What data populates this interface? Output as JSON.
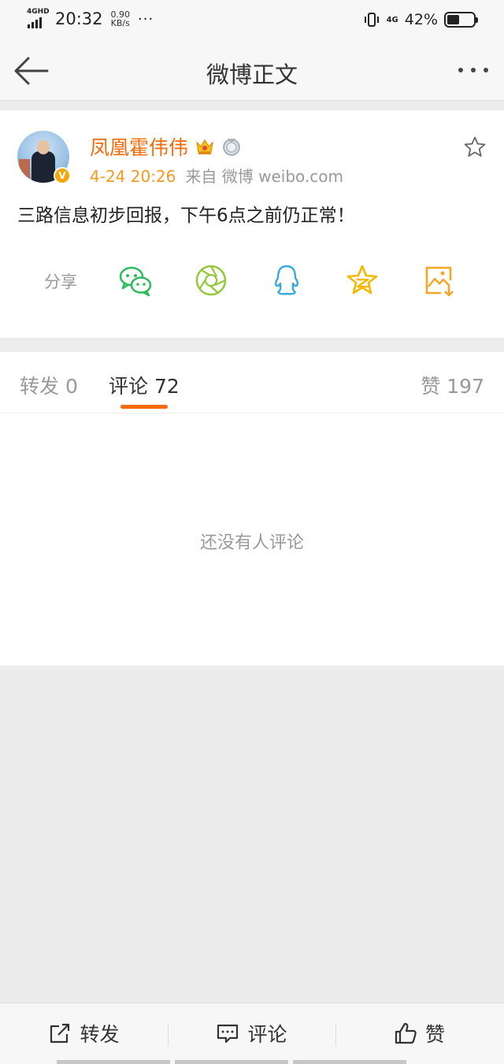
{
  "status_bar": {
    "network": "4GHD",
    "time": "20:32",
    "speed_value": "0.90",
    "speed_unit": "KB/s",
    "more": "···",
    "network_right": "4G",
    "battery": "42%",
    "battery_level": 0.42
  },
  "nav": {
    "back_icon": "arrow-left-icon",
    "title": "微博正文",
    "more_icon": "more-dots-icon"
  },
  "post": {
    "author": "凤凰霍伟伟",
    "verified_badge": "V",
    "time": "4-24 20:26",
    "source": "来自 微博 weibo.com",
    "text": "三路信息初步回报，下午6点之前仍正常！",
    "share_label": "分享",
    "share_targets": [
      {
        "icon": "wechat-icon",
        "color": "#2dbb5c"
      },
      {
        "icon": "moments-icon",
        "color": "#93c83a"
      },
      {
        "icon": "qq-icon",
        "color": "#35a9e3"
      },
      {
        "icon": "qzone-icon",
        "color": "#f5b800"
      },
      {
        "icon": "save-image-icon",
        "color": "#f5a623"
      }
    ]
  },
  "tabs": {
    "repost": "转发 0",
    "comment": "评论 72",
    "like": "赞 197",
    "active": "comment",
    "accent_color": "#f36b0a"
  },
  "comments": {
    "empty_text": "还没有人评论"
  },
  "bottom_bar": {
    "repost": "转发",
    "comment": "评论",
    "like": "赞"
  }
}
